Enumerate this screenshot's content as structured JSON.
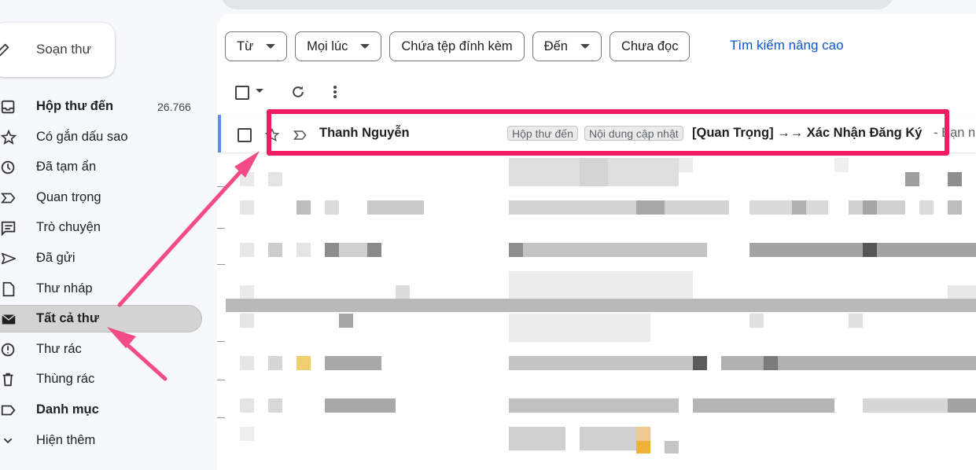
{
  "compose": {
    "label": "Soạn thư"
  },
  "sidebar": {
    "items": [
      {
        "label": "Hộp thư đến",
        "count": "26.766",
        "icon": "inbox-icon",
        "bold": true
      },
      {
        "label": "Có gắn dấu sao",
        "icon": "star-icon"
      },
      {
        "label": "Đã tạm ẩn",
        "icon": "clock-icon"
      },
      {
        "label": "Quan trọng",
        "icon": "important-icon"
      },
      {
        "label": "Trò chuyện",
        "icon": "chat-icon"
      },
      {
        "label": "Đã gửi",
        "icon": "send-icon"
      },
      {
        "label": "Thư nháp",
        "icon": "draft-icon"
      },
      {
        "label": "Tất cả thư",
        "icon": "all-mail-icon",
        "active": true
      },
      {
        "label": "Thư rác",
        "icon": "spam-icon"
      },
      {
        "label": "Thùng rác",
        "icon": "trash-icon"
      },
      {
        "label": "Danh mục",
        "icon": "label-icon",
        "bold": true
      },
      {
        "label": "Hiện thêm",
        "icon": "chevron-down-icon"
      }
    ]
  },
  "filters": {
    "from": "Từ",
    "anytime": "Mọi lúc",
    "has_attachment": "Chứa tệp đính kèm",
    "to": "Đến",
    "unread": "Chưa đọc",
    "advanced_search": "Tìm kiếm nâng cao"
  },
  "email": {
    "sender": "Thanh Nguyễn",
    "labels": [
      "Hộp thư đến",
      "Nội dung cập nhật"
    ],
    "subject": "[Quan Trọng] →→ Xác Nhận Đăng Ký",
    "snippet": "- Bạn n"
  },
  "colors": {
    "highlight": "#f21b63",
    "link": "#0b57d0",
    "accent": "#5b8fe6"
  }
}
